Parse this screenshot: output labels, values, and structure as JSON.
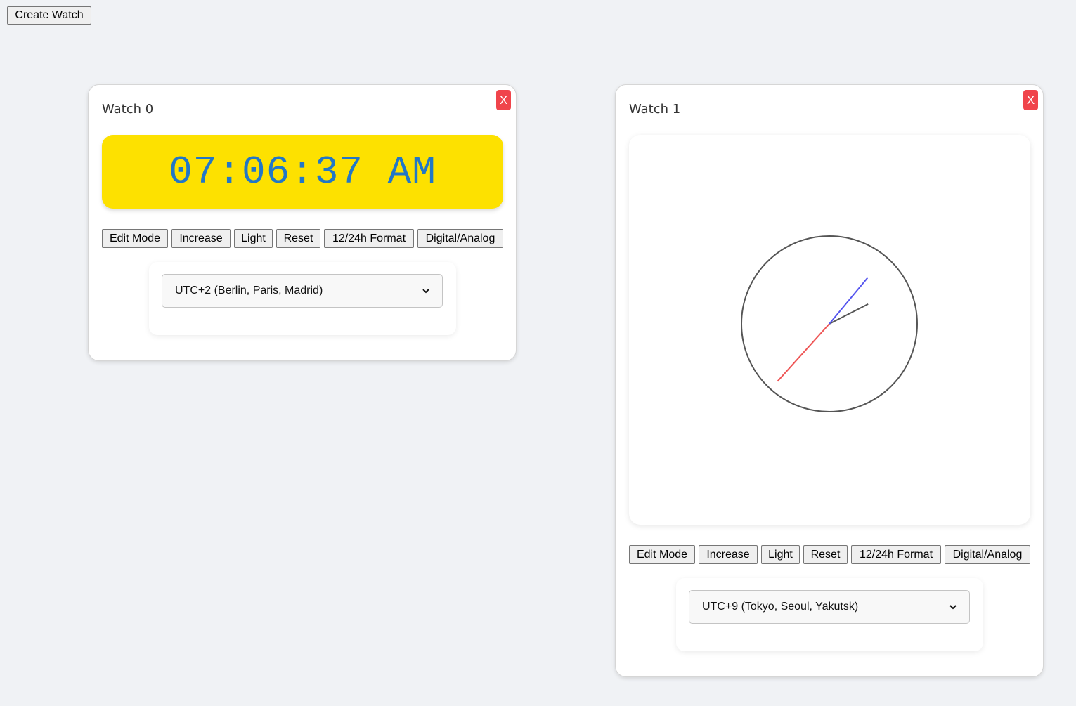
{
  "toolbar": {
    "create_label": "Create Watch"
  },
  "watches": [
    {
      "title": "Watch 0",
      "close_label": "X",
      "mode": "digital",
      "display_time": "07:06:37 AM",
      "display_bg": "#fde100",
      "display_color": "#2277c7",
      "controls": [
        "Edit Mode",
        "Increase",
        "Light",
        "Reset",
        "12/24h Format",
        "Digital/Analog"
      ],
      "timezone": "UTC+2 (Berlin, Paris, Madrid)"
    },
    {
      "title": "Watch 1",
      "close_label": "X",
      "mode": "analog",
      "analog_time": {
        "hours": 2,
        "minutes": 6,
        "seconds": 37
      },
      "hand_colors": {
        "hour": "#555555",
        "minute": "#5555ee",
        "second": "#ee5555"
      },
      "controls": [
        "Edit Mode",
        "Increase",
        "Light",
        "Reset",
        "12/24h Format",
        "Digital/Analog"
      ],
      "timezone": "UTC+9 (Tokyo, Seoul, Yakutsk)"
    }
  ],
  "colors": {
    "close_button": "#f0444b",
    "page_background": "#f0f2f5"
  }
}
